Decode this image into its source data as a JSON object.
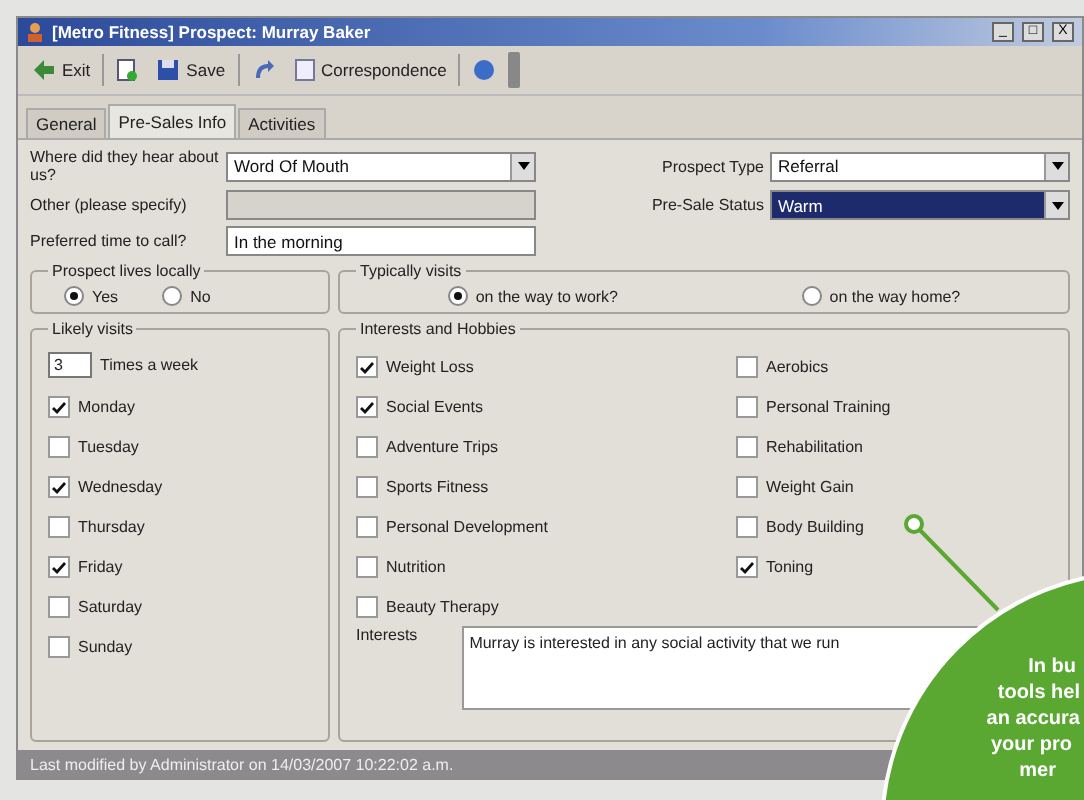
{
  "window": {
    "title": "[Metro Fitness] Prospect: Murray  Baker",
    "controls": [
      "_",
      "□",
      "X"
    ]
  },
  "toolbar": [
    {
      "kind": "exit",
      "label": "Exit"
    },
    {
      "kind": "new"
    },
    {
      "kind": "save",
      "label": "Save"
    },
    {
      "kind": "undo"
    },
    {
      "kind": "doc",
      "label": "Correspondence"
    },
    {
      "kind": "globe"
    }
  ],
  "tabs": [
    {
      "label": "General",
      "selected": false
    },
    {
      "label": "Pre-Sales Info",
      "selected": true
    },
    {
      "label": "Activities",
      "selected": false
    }
  ],
  "form": {
    "heard_label": "Where did they hear about us?",
    "heard_value": "Word Of Mouth",
    "other_label": "Other (please specify)",
    "other_value_disabled": true,
    "time_label": "Preferred time to call?",
    "time_value": "In the morning",
    "type_label": "Prospect Type",
    "type_value": "Referral",
    "status_label": "Pre-Sale Status",
    "status_value": "Warm",
    "status_selected": true
  },
  "lives_locally": {
    "title": "Prospect lives locally",
    "options": [
      {
        "label": "Yes",
        "selected": true
      },
      {
        "label": "No",
        "selected": false
      }
    ]
  },
  "typically_visits": {
    "title": "Typically visits",
    "options": [
      {
        "label": "on the way to work?",
        "selected": true
      },
      {
        "label": "on the way home?",
        "selected": false
      }
    ]
  },
  "likely_visits": {
    "title": "Likely visits",
    "times": "3",
    "times_label": "Times a week",
    "days": [
      {
        "label": "Monday",
        "checked": true
      },
      {
        "label": "Tuesday",
        "checked": false
      },
      {
        "label": "Wednesday",
        "checked": true
      },
      {
        "label": "Thursday",
        "checked": false
      },
      {
        "label": "Friday",
        "checked": true
      },
      {
        "label": "Saturday",
        "checked": false
      },
      {
        "label": "Sunday",
        "checked": false
      }
    ]
  },
  "interests": {
    "title": "Interests and Hobbies",
    "columns": [
      [
        {
          "label": "Weight Loss",
          "checked": true
        },
        {
          "label": "Social Events",
          "checked": true
        },
        {
          "label": "Adventure Trips",
          "checked": false
        },
        {
          "label": "Sports Fitness",
          "checked": false
        },
        {
          "label": "Personal Development",
          "checked": false
        },
        {
          "label": "Nutrition",
          "checked": false
        },
        {
          "label": "Beauty Therapy",
          "checked": false
        }
      ],
      [
        {
          "label": "Aerobics",
          "checked": false
        },
        {
          "label": "Personal Training",
          "checked": false
        },
        {
          "label": "Rehabilitation",
          "checked": false
        },
        {
          "label": "Weight Gain",
          "checked": false
        },
        {
          "label": "Body Building",
          "checked": false
        },
        {
          "label": "Toning",
          "checked": true
        }
      ]
    ],
    "notes_label": "Interests",
    "notes_value": "Murray is interested in any social activity that we run"
  },
  "status_bar": "Last modified by Administrator on 14/03/2007 10:22:02 a.m.",
  "callout": {
    "lines": [
      "In bu",
      "tools hel",
      "an accura",
      "your pro",
      "mer"
    ]
  }
}
